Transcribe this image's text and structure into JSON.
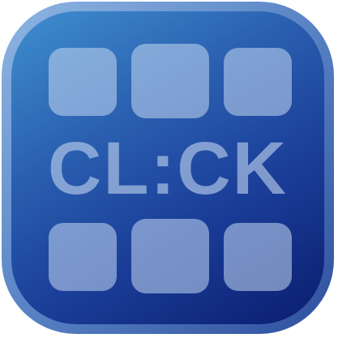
{
  "app_icon": {
    "logo_text": "CL:CK",
    "colors": {
      "frame_light": "#8fb6e2",
      "frame_dark": "#2e4f9e",
      "face_top": "#3f8fd0",
      "face_bottom": "#0a1d6e",
      "tile": "#bed2ee"
    },
    "tiles": [
      {
        "name": "tile-top-left"
      },
      {
        "name": "tile-top-center"
      },
      {
        "name": "tile-top-right"
      },
      {
        "name": "tile-bottom-left"
      },
      {
        "name": "tile-bottom-center"
      },
      {
        "name": "tile-bottom-right"
      }
    ]
  }
}
